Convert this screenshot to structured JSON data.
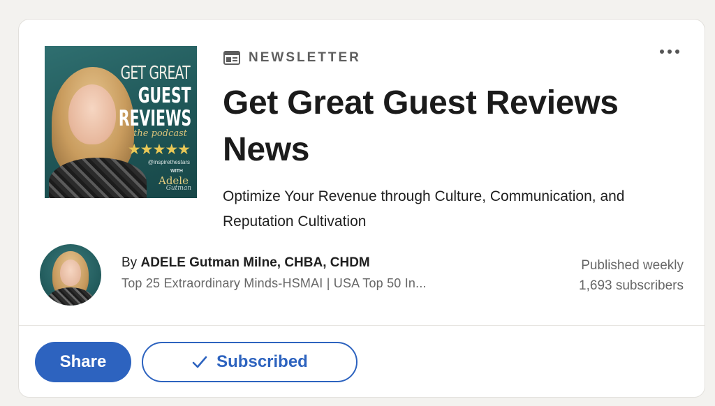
{
  "cover": {
    "line1": "GET GREAT",
    "line2": "GUEST",
    "line3": "REVIEWS",
    "line4": "the podcast",
    "stars": "★★★★★",
    "handle": "@inspirethestars",
    "with": "WITH",
    "first_name": "Adele",
    "last_name": "Gutman"
  },
  "label": "NEWSLETTER",
  "icons": {
    "newsletter": "newsletter-icon",
    "more": "more-icon",
    "check": "check-icon"
  },
  "title": "Get Great Guest Reviews News",
  "description": "Optimize Your Revenue through Culture, Communication, and Reputation Cultivation",
  "author": {
    "prefix": "By",
    "name": "ADELE Gutman Milne, CHBA, CHDM",
    "headline": "Top 25 Extraordinary Minds-HSMAI | USA Top 50 In..."
  },
  "meta": {
    "frequency": "Published weekly",
    "subscribers": "1,693 subscribers"
  },
  "actions": {
    "share_label": "Share",
    "subscribed_label": "Subscribed"
  },
  "colors": {
    "accent": "#2d63bf",
    "background": "#f3f2ef",
    "card": "#ffffff"
  }
}
